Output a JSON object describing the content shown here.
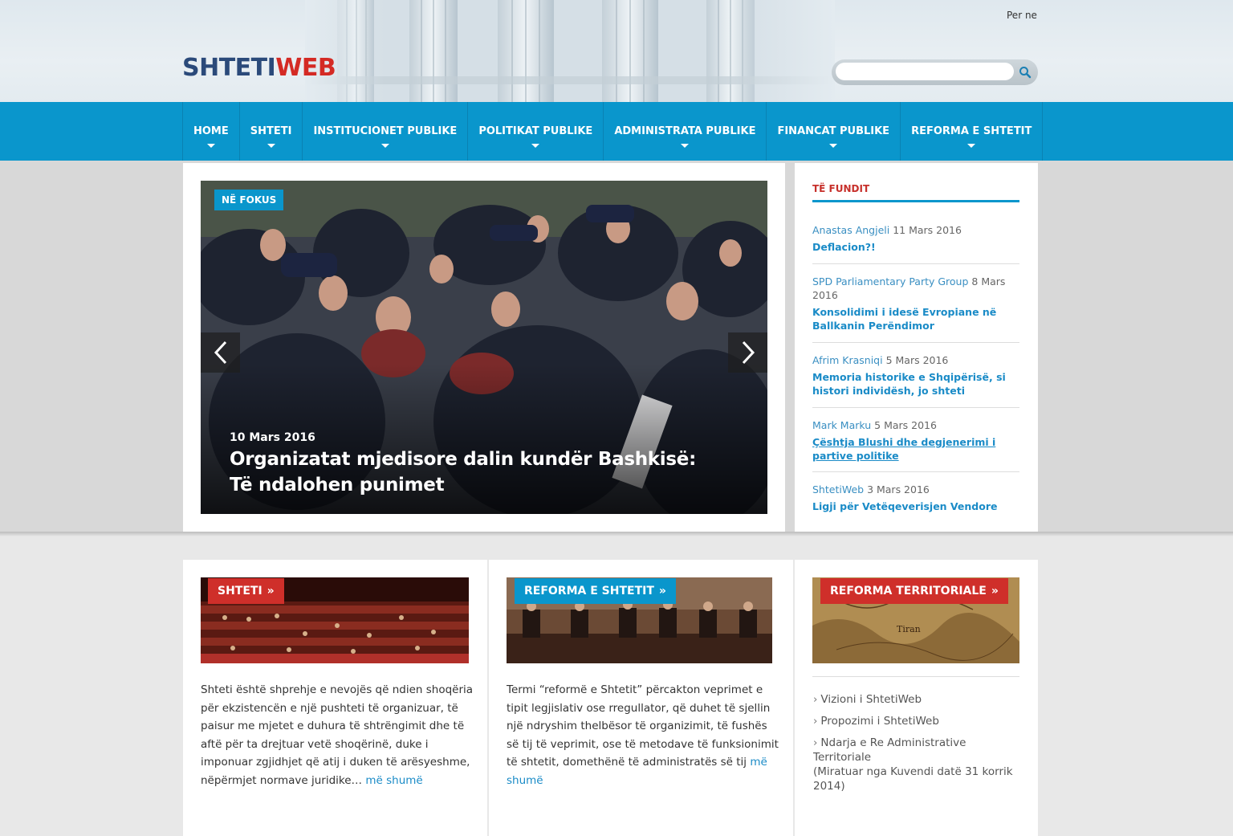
{
  "header": {
    "logo_part1": "SHTETI",
    "logo_part2": "WEB",
    "top_link": "Per ne",
    "search_placeholder": ""
  },
  "nav": [
    {
      "label": "HOME"
    },
    {
      "label": "SHTETI"
    },
    {
      "label": "INSTITUCIONET PUBLIKE"
    },
    {
      "label": "POLITIKAT PUBLIKE"
    },
    {
      "label": "ADMINISTRATA PUBLIKE"
    },
    {
      "label": "FINANCAT PUBLIKE"
    },
    {
      "label": "REFORMA E SHTETIT"
    }
  ],
  "feature": {
    "tag": "NË FOKUS",
    "date": "10 Mars 2016",
    "title": "Organizatat mjedisore dalin kundër Bashkisë: Të ndalohen punimet"
  },
  "latest": {
    "heading": "TË FUNDIT",
    "items": [
      {
        "author": "Anastas Angjeli",
        "date": "11 Mars 2016",
        "title": "Deflacion?!"
      },
      {
        "author": "SPD Parliamentary Party Group",
        "date": "8 Mars 2016",
        "title": "Konsolidimi i idesë Evropiane në Ballkanin Perëndimor"
      },
      {
        "author": "Afrim Krasniqi",
        "date": "5 Mars 2016",
        "title": "Memoria historike e Shqipërisë, si histori individësh, jo shteti"
      },
      {
        "author": "Mark Marku",
        "date": "5 Mars 2016",
        "title": "Çështja Blushi dhe degjenerimi i partive politike"
      },
      {
        "author": "ShtetiWeb",
        "date": "3 Mars 2016",
        "title": "Ligji për Vetëqeverisjen Vendore"
      }
    ]
  },
  "boxes": {
    "box1": {
      "tag": "SHTETI",
      "text": "Shteti është shprehje e nevojës që ndien shoqëria për ekzistencën e një pushteti të organizuar, të paisur me mjetet e duhura të shtrëngimit dhe të aftë për ta drejtuar vetë shoqërinë, duke i imponuar zgjidhjet që atij i duken të arësyeshme, nëpërmjet normave juridike…",
      "more": "më shumë"
    },
    "box2": {
      "tag": "REFORMA E SHTETIT",
      "text": "Termi “reformë e Shtetit” përcakton veprimet e tipit legjislativ ose rregullator, që duhet të sjellin një ndryshim thelbësor të organizimit, të fushës së tij të veprimit, ose të metodave të funksionimit të shtetit, domethënë të administratës së tij",
      "more": "më shumë"
    },
    "box3": {
      "tag": "REFORMA TERRITORIALE",
      "map_label": "Tiran",
      "links": [
        {
          "text": "Vizioni i ShtetiWeb"
        },
        {
          "text": "Propozimi i ShtetiWeb"
        },
        {
          "text": "Ndarja e Re Administrative Territoriale",
          "note": "(Miratuar nga Kuvendi datë 31 korrik 2014)"
        }
      ]
    }
  },
  "chevron": "»",
  "colors": {
    "nav": "#0a96cc",
    "accent_red": "#cf2f2a",
    "link": "#1a8bc7"
  }
}
